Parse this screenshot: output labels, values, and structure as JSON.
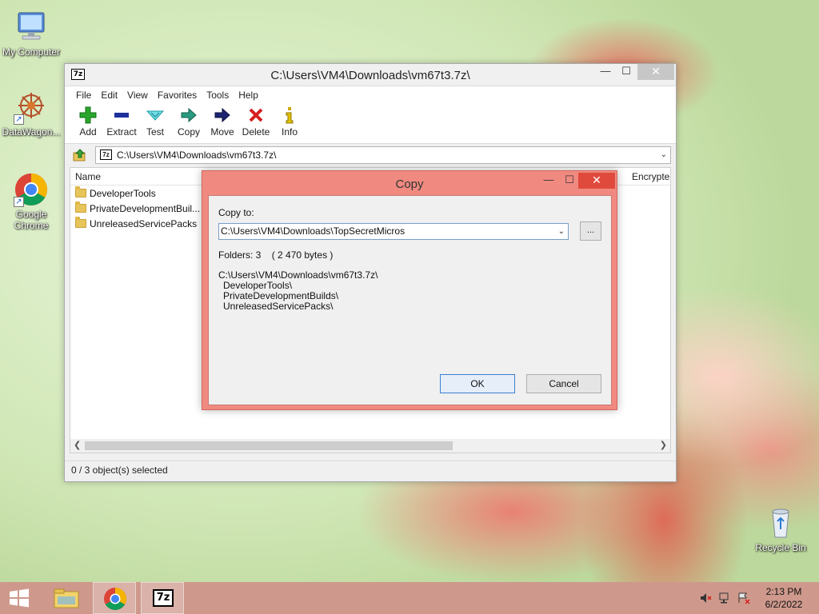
{
  "desktop": {
    "icons": [
      {
        "label": "My Computer",
        "icon": "computer-icon"
      },
      {
        "label": "DataWagon...",
        "icon": "datawagon-icon"
      },
      {
        "label": "Google Chrome",
        "icon": "chrome-icon"
      },
      {
        "label": "Recycle Bin",
        "icon": "recycle-bin-icon"
      }
    ]
  },
  "main_window": {
    "title": "C:\\Users\\VM4\\Downloads\\vm67t3.7z\\",
    "app_icon_text": "7z",
    "controls": {
      "minimize": "—",
      "maximize": "☐",
      "close": "✕"
    },
    "menu": [
      "File",
      "Edit",
      "View",
      "Favorites",
      "Tools",
      "Help"
    ],
    "toolbar": [
      {
        "label": "Add",
        "icon": "add-icon",
        "color": "#2aa52a"
      },
      {
        "label": "Extract",
        "icon": "extract-icon",
        "color": "#1c2f9c"
      },
      {
        "label": "Test",
        "icon": "test-icon",
        "color": "#2bbcc7"
      },
      {
        "label": "Copy",
        "icon": "copy-icon",
        "color": "#2a9a80"
      },
      {
        "label": "Move",
        "icon": "move-icon",
        "color": "#1c2470"
      },
      {
        "label": "Delete",
        "icon": "delete-icon",
        "color": "#d42020"
      },
      {
        "label": "Info",
        "icon": "info-icon",
        "color": "#c9a800"
      }
    ],
    "address": "C:\\Users\\VM4\\Downloads\\vm67t3.7z\\",
    "columns": {
      "name": "Name",
      "right": "Encrypte"
    },
    "files": [
      "DeveloperTools",
      "PrivateDevelopmentBuil...",
      "UnreleasedServicePacks"
    ],
    "status": "0 / 3 object(s) selected"
  },
  "copy_dialog": {
    "title": "Copy",
    "controls": {
      "minimize": "—",
      "maximize": "☐",
      "close": "✕"
    },
    "copy_to_label": "Copy to:",
    "copy_to_value": "C:\\Users\\VM4\\Downloads\\TopSecretMicros",
    "browse_label": "...",
    "stats": "Folders: 3    ( 2 470 bytes )",
    "source_path": "C:\\Users\\VM4\\Downloads\\vm67t3.7z\\",
    "items": [
      "DeveloperTools\\",
      "PrivateDevelopmentBuilds\\",
      "UnreleasedServicePacks\\"
    ],
    "ok_label": "OK",
    "cancel_label": "Cancel"
  },
  "taskbar": {
    "items": [
      {
        "name": "file-explorer",
        "icon": "folder-icon"
      },
      {
        "name": "google-chrome",
        "icon": "chrome-icon"
      },
      {
        "name": "7-zip",
        "icon": "7zip-icon",
        "text": "7z"
      }
    ],
    "time": "2:13 PM",
    "date": "6/2/2022"
  }
}
